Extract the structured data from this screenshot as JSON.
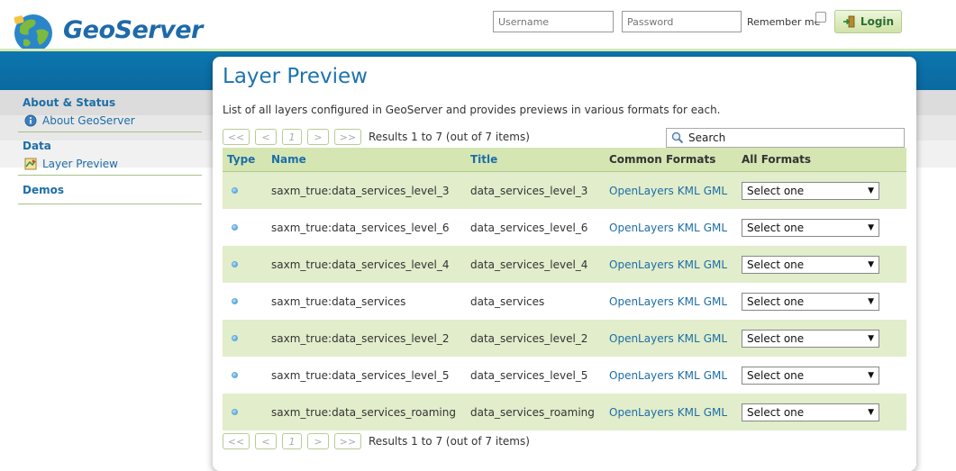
{
  "header": {
    "logo_text": "GeoServer",
    "username_placeholder": "Username",
    "password_placeholder": "Password",
    "remember_label": "Remember me",
    "login_label": "Login"
  },
  "sidebar": {
    "sections": [
      {
        "title": "About & Status",
        "items": [
          {
            "label": "About GeoServer",
            "icon": "info-icon"
          }
        ]
      },
      {
        "title": "Data",
        "items": [
          {
            "label": "Layer Preview",
            "icon": "layer-preview-icon"
          }
        ]
      },
      {
        "title": "Demos",
        "items": []
      }
    ]
  },
  "main": {
    "title": "Layer Preview",
    "description": "List of all layers configured in GeoServer and provides previews in various formats for each.",
    "pager": {
      "first": "<<",
      "prev": "<",
      "page": "1",
      "next": ">",
      "last": ">>",
      "results": "Results 1 to 7 (out of 7 items)"
    },
    "search_placeholder": "Search",
    "table": {
      "headers": {
        "type": "Type",
        "name": "Name",
        "title": "Title",
        "common": "Common Formats",
        "all": "All Formats"
      },
      "format_links": [
        "OpenLayers",
        "KML",
        "GML"
      ],
      "select_default": "Select one",
      "rows": [
        {
          "name": "saxm_true:data_services_level_3",
          "title": "data_services_level_3"
        },
        {
          "name": "saxm_true:data_services_level_6",
          "title": "data_services_level_6"
        },
        {
          "name": "saxm_true:data_services_level_4",
          "title": "data_services_level_4"
        },
        {
          "name": "saxm_true:data_services",
          "title": "data_services"
        },
        {
          "name": "saxm_true:data_services_level_2",
          "title": "data_services_level_2"
        },
        {
          "name": "saxm_true:data_services_level_5",
          "title": "data_services_level_5"
        },
        {
          "name": "saxm_true:data_services_roaming",
          "title": "data_services_roaming"
        }
      ]
    }
  },
  "colors": {
    "brand_blue": "#1e6aa9",
    "header_band": "#0d76ae",
    "row_green": "#e1edcb",
    "header_green": "#d5e6b3"
  }
}
